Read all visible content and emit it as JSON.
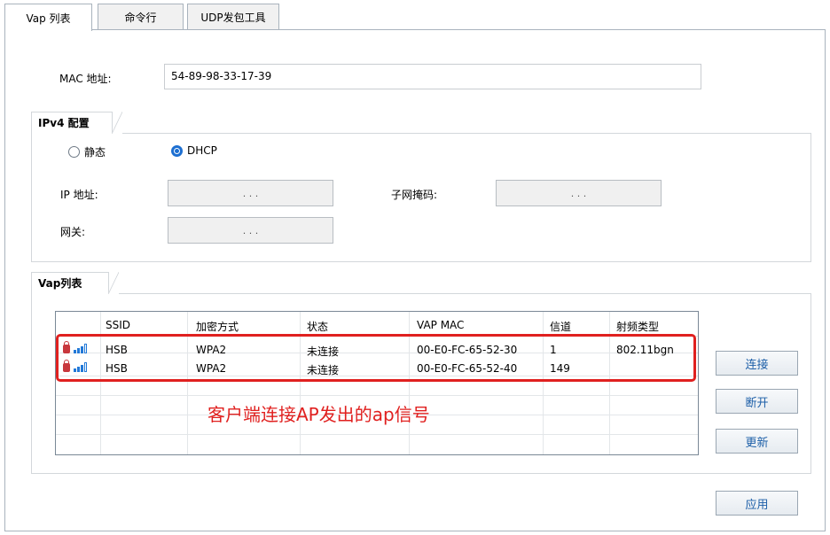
{
  "tabs": [
    {
      "label": "Vap 列表",
      "active": true
    },
    {
      "label": "命令行",
      "active": false
    },
    {
      "label": "UDP发包工具",
      "active": false
    }
  ],
  "mac": {
    "label": "MAC 地址:",
    "value": "54-89-98-33-17-39"
  },
  "ipv4": {
    "group_title": "IPv4 配置",
    "static_label": "静态",
    "dhcp_label": "DHCP",
    "selected_mode": "DHCP",
    "ip_label": "IP 地址:",
    "mask_label": "子网掩码:",
    "gateway_label": "网关:",
    "ip_dots": ".  .  .",
    "mask_dots": ".  .  .",
    "gateway_dots": ".  .  ."
  },
  "vap": {
    "group_title": "Vap列表",
    "columns": [
      "SSID",
      "加密方式",
      "状态",
      "VAP MAC",
      "信道",
      "射频类型"
    ],
    "rows": [
      {
        "ssid": "HSB",
        "encryption": "WPA2",
        "status": "未连接",
        "vap_mac": "00-E0-FC-65-52-30",
        "channel": "1",
        "radio": "802.11bgn",
        "locked": true,
        "signal_level": "3/4"
      },
      {
        "ssid": "HSB",
        "encryption": "WPA2",
        "status": "未连接",
        "vap_mac": "00-E0-FC-65-52-40",
        "channel": "149",
        "radio": "",
        "locked": true,
        "signal_level": "3/4"
      }
    ]
  },
  "annotation": {
    "text": "客户端连接AP发出的ap信号",
    "color": "#e0201f"
  },
  "buttons": {
    "connect": "连接",
    "disconnect": "断开",
    "refresh": "更新",
    "apply": "应用"
  },
  "colors": {
    "accent": "#1d6fd1",
    "button_text": "#1d5fa8",
    "highlight": "#e0201f"
  }
}
